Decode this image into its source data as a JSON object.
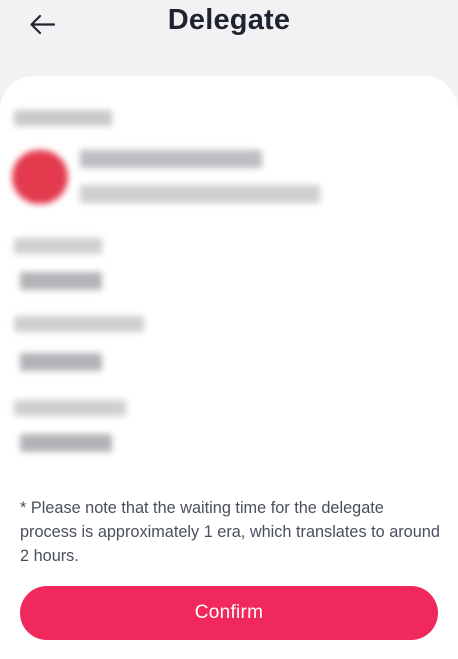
{
  "header": {
    "title": "Delegate",
    "back_icon": "arrow-left-icon"
  },
  "colors": {
    "accent": "#f0285b",
    "background": "#f2f2f4",
    "card": "#ffffff",
    "title_text": "#1f2330",
    "note_text": "#4a4f5e"
  },
  "details": {
    "redacted": true,
    "validator_avatar_icon": "validator-avatar-icon"
  },
  "note": {
    "text": "* Please note that the waiting time for the delegate process is approximately 1 era, which translates to around 2 hours."
  },
  "actions": {
    "confirm_label": "Confirm"
  }
}
